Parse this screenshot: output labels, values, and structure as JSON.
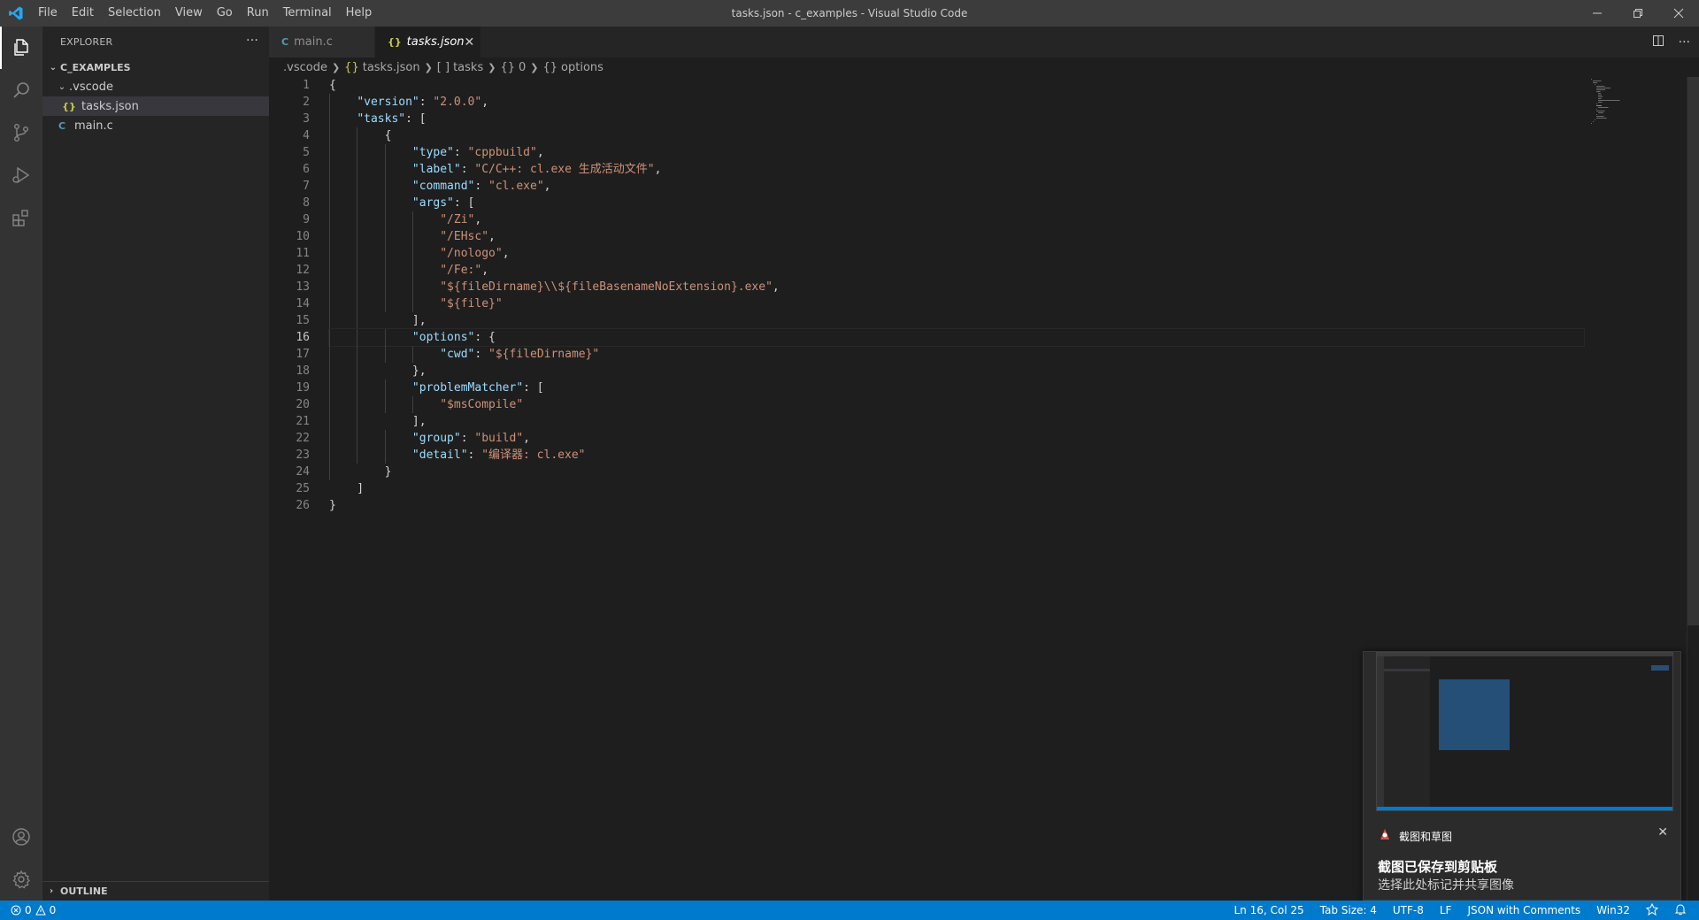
{
  "titlebar": {
    "app_icon": "vscode-logo-icon",
    "menu": [
      "File",
      "Edit",
      "Selection",
      "View",
      "Go",
      "Run",
      "Terminal",
      "Help"
    ],
    "title": "tasks.json - c_examples - Visual Studio Code"
  },
  "activitybar": {
    "items": [
      "explorer-icon",
      "search-icon",
      "source-control-icon",
      "run-debug-icon",
      "extensions-icon"
    ],
    "bottom": [
      "account-icon",
      "settings-gear-icon"
    ]
  },
  "sidebar": {
    "header": "EXPLORER",
    "more": "···",
    "root": "C_EXAMPLES",
    "folder": ".vscode",
    "files": [
      {
        "icon": "{}",
        "name": "tasks.json"
      },
      {
        "icon": "C",
        "name": "main.c"
      }
    ],
    "outline": "OUTLINE"
  },
  "tabs": [
    {
      "icon": "C",
      "label": "main.c"
    },
    {
      "icon": "{}",
      "label": "tasks.json",
      "close": "✕"
    }
  ],
  "breadcrumb": {
    "folder": ".vscode",
    "file_icon": "{}",
    "file": "tasks.json",
    "tasks_icon": "[ ]",
    "tasks": "tasks",
    "item_icon": "{}",
    "item": "0",
    "options_icon": "{}",
    "options": "options"
  },
  "editor": {
    "current_line": 16,
    "lines": [
      "{",
      "    \"version\": \"2.0.0\",",
      "    \"tasks\": [",
      "        {",
      "            \"type\": \"cppbuild\",",
      "            \"label\": \"C/C++: cl.exe 生成活动文件\",",
      "            \"command\": \"cl.exe\",",
      "            \"args\": [",
      "                \"/Zi\",",
      "                \"/EHsc\",",
      "                \"/nologo\",",
      "                \"/Fe:\",",
      "                \"${fileDirname}\\\\${fileBasenameNoExtension}.exe\",",
      "                \"${file}\"",
      "            ],",
      "            \"options\": {",
      "                \"cwd\": \"${fileDirname}\"",
      "            },",
      "            \"problemMatcher\": [",
      "                \"$msCompile\"",
      "            ],",
      "            \"group\": \"build\",",
      "            \"detail\": \"编译器: cl.exe\"",
      "        }",
      "    ]",
      "}"
    ]
  },
  "statusbar": {
    "errors": "0",
    "warnings": "0",
    "position": "Ln 16, Col 25",
    "tab_size": "Tab Size: 4",
    "encoding": "UTF-8",
    "eol": "LF",
    "language": "JSON with Comments",
    "platform": "Win32"
  },
  "notification": {
    "app": "截图和草图",
    "title": "截图已保存到剪贴板",
    "body": "选择此处标记并共享图像",
    "close": "✕"
  },
  "colors": {
    "accent": "#007acc",
    "key": "#9cdcfe",
    "string": "#ce9178",
    "json_icon": "#cbcb41",
    "c_icon": "#519aba"
  }
}
